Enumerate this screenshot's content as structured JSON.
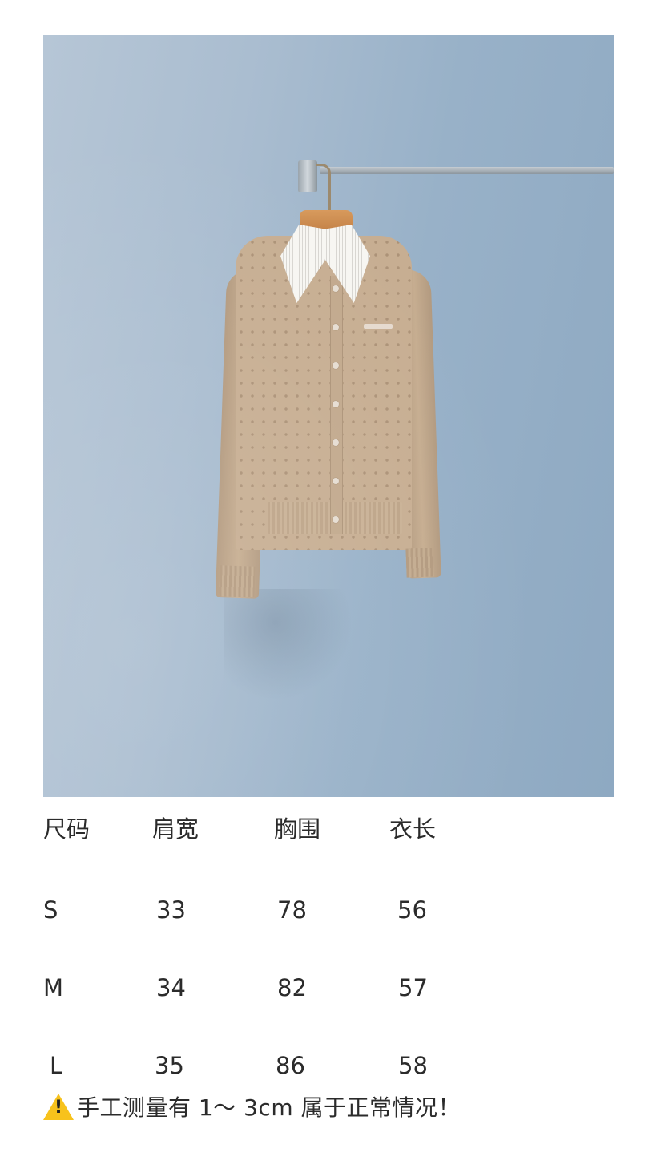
{
  "image": {
    "label": "beige knit cardigan with striped shirt collar on hanger against blue wall"
  },
  "size_table": {
    "headers": [
      "尺码",
      "肩宽",
      "胸围",
      "衣长"
    ],
    "rows": [
      [
        "S",
        "33",
        "78",
        "56"
      ],
      [
        "M",
        "34",
        "82",
        "57"
      ],
      [
        "L",
        "35",
        "86",
        "58"
      ]
    ]
  },
  "note": {
    "icon": "warning-icon",
    "text": "手工测量有 1～ 3cm 属于正常情况！"
  },
  "colors": {
    "background": "#ffffff",
    "wall": "#a4b8cc",
    "garment": "#c7ae92",
    "warning": "#f7c21c"
  }
}
